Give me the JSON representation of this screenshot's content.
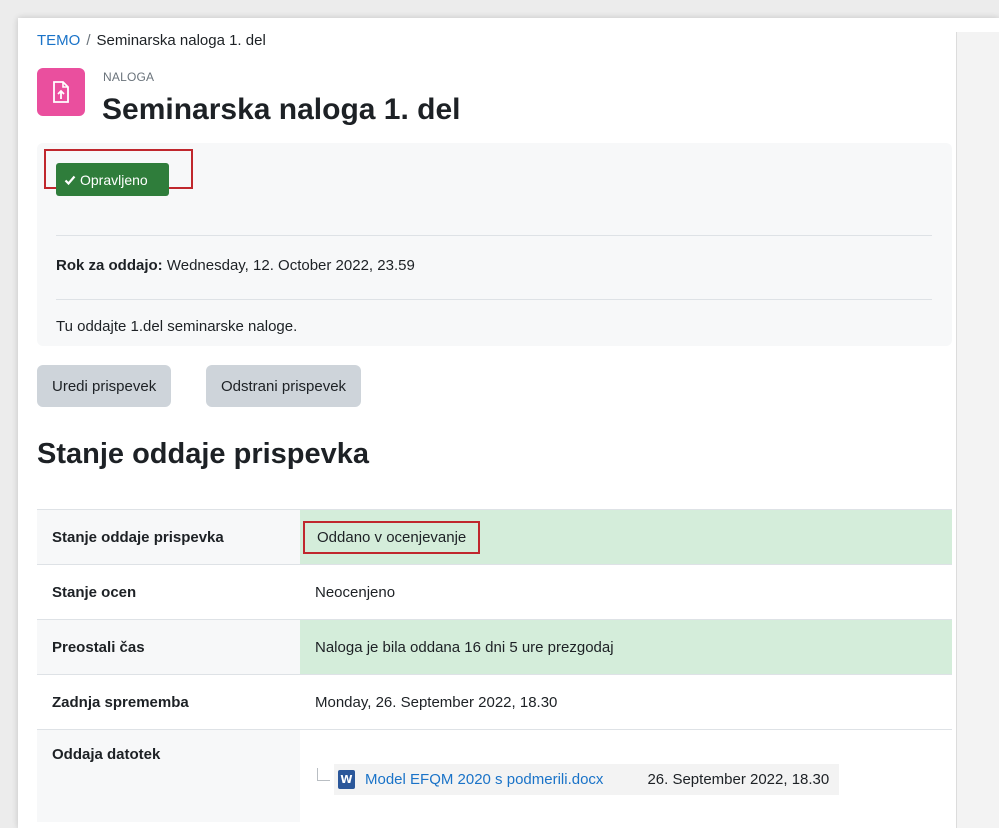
{
  "breadcrumb": {
    "course": "TEMO",
    "separator": "/",
    "current": "Seminarska naloga 1. del"
  },
  "activity": {
    "type_label": "NALOGA",
    "title": "Seminarska naloga 1. del",
    "icon": "assignment-upload-icon",
    "icon_color": "#ea4f9e"
  },
  "completion": {
    "button_label": "Opravljeno",
    "icon": "check-icon",
    "color": "#2f7d3b"
  },
  "dates": {
    "due_label": "Rok za oddajo:",
    "due_value": "Wednesday, 12. October 2022, 23.59"
  },
  "intro": "Tu oddajte 1.del seminarske naloge.",
  "actions": {
    "edit_label": "Uredi prispevek",
    "remove_label": "Odstrani prispevek"
  },
  "section_heading": "Stanje oddaje prispevka",
  "status_table": {
    "rows": [
      {
        "label": "Stanje oddaje prispevka",
        "value": "Oddano v ocenjevanje"
      },
      {
        "label": "Stanje ocen",
        "value": "Neocenjeno"
      },
      {
        "label": "Preostali čas",
        "value": "Naloga je bila oddana 16 dni 5 ure prezgodaj"
      },
      {
        "label": "Zadnja sprememba",
        "value": "Monday, 26. September 2022, 18.30"
      },
      {
        "label": "Oddaja datotek",
        "file_name": "Model EFQM 2020 s podmerili.docx",
        "file_date": "26. September 2022, 18.30",
        "file_icon": "word-document-icon"
      }
    ]
  },
  "colors": {
    "highlight_border": "#c0272d",
    "status_green": "#d4edda",
    "link": "#1a73c8"
  }
}
